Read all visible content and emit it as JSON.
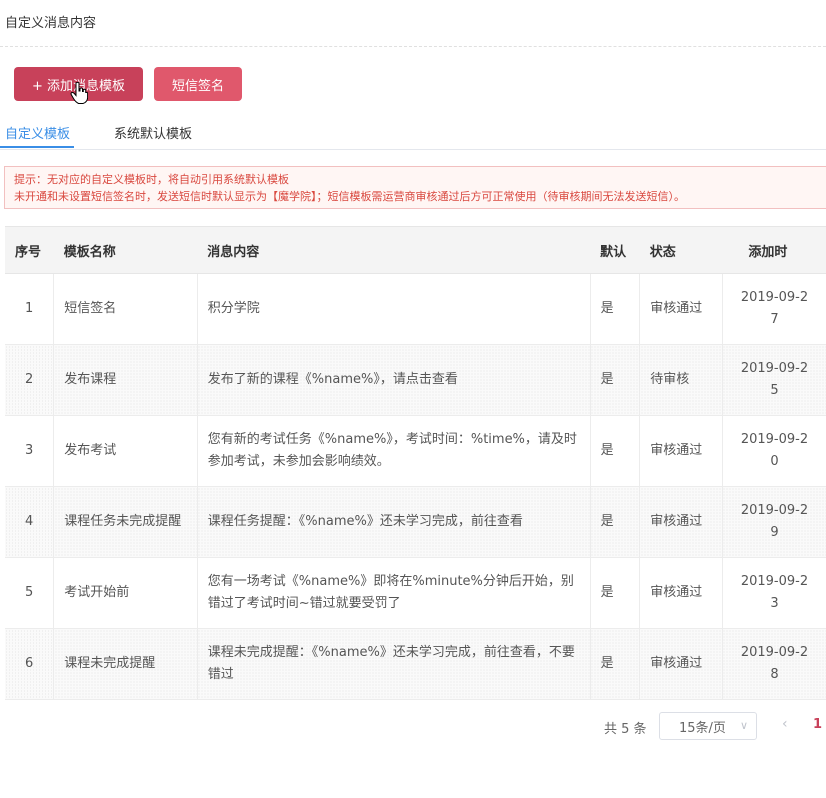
{
  "page": {
    "title": "自定义消息内容"
  },
  "toolbar": {
    "add_template": "+ 添加消息模板",
    "sms_sign": "短信签名"
  },
  "tabs": [
    {
      "label": "自定义模板",
      "active": true
    },
    {
      "label": "系统默认模板",
      "active": false
    }
  ],
  "notice": {
    "line1": "提示：无对应的自定义模板时，将自动引用系统默认模板",
    "line2": "未开通和未设置短信签名时，发送短信时默认显示为【魔学院】；短信模板需运营商审核通过后方可正常使用（待审核期间无法发送短信）。"
  },
  "table": {
    "headers": [
      "序号",
      "模板名称",
      "消息内容",
      "默认",
      "状态",
      "添加时"
    ],
    "rows": [
      {
        "no": "1",
        "name": "短信签名",
        "content": "积分学院",
        "default": "是",
        "status": "审核通过",
        "date1": "2019-09-2",
        "date2": "7"
      },
      {
        "no": "2",
        "name": "发布课程",
        "content": "发布了新的课程《%name%》，请点击查看",
        "default": "是",
        "status": "待审核",
        "date1": "2019-09-2",
        "date2": "5"
      },
      {
        "no": "3",
        "name": "发布考试",
        "content": "您有新的考试任务《%name%》，考试时间：%time%，请及时参加考试，未参加会影响绩效。",
        "default": "是",
        "status": "审核通过",
        "date1": "2019-09-2",
        "date2": "0"
      },
      {
        "no": "4",
        "name": "课程任务未完成提醒",
        "content": "课程任务提醒：《%name%》还未学习完成，前往查看",
        "default": "是",
        "status": "审核通过",
        "date1": "2019-09-2",
        "date2": "9"
      },
      {
        "no": "5",
        "name": "考试开始前",
        "content": "您有一场考试《%name%》即将在%minute%分钟后开始，别错过了考试时间~错过就要受罚了",
        "default": "是",
        "status": "审核通过",
        "date1": "2019-09-2",
        "date2": "3"
      },
      {
        "no": "6",
        "name": "课程未完成提醒",
        "content": "课程未完成提醒：《%name%》还未学习完成，前往查看，不要错过",
        "default": "是",
        "status": "审核通过",
        "date1": "2019-09-2",
        "date2": "8"
      }
    ]
  },
  "pagination": {
    "total": "共 5 条",
    "page_size": "15条/页",
    "prev_icon": "chevron-left-icon",
    "current": "1"
  },
  "colors": {
    "primary": "#c8415a",
    "secondary": "#e0586c",
    "link": "#3a8ee6",
    "warning": "#d9483f"
  }
}
